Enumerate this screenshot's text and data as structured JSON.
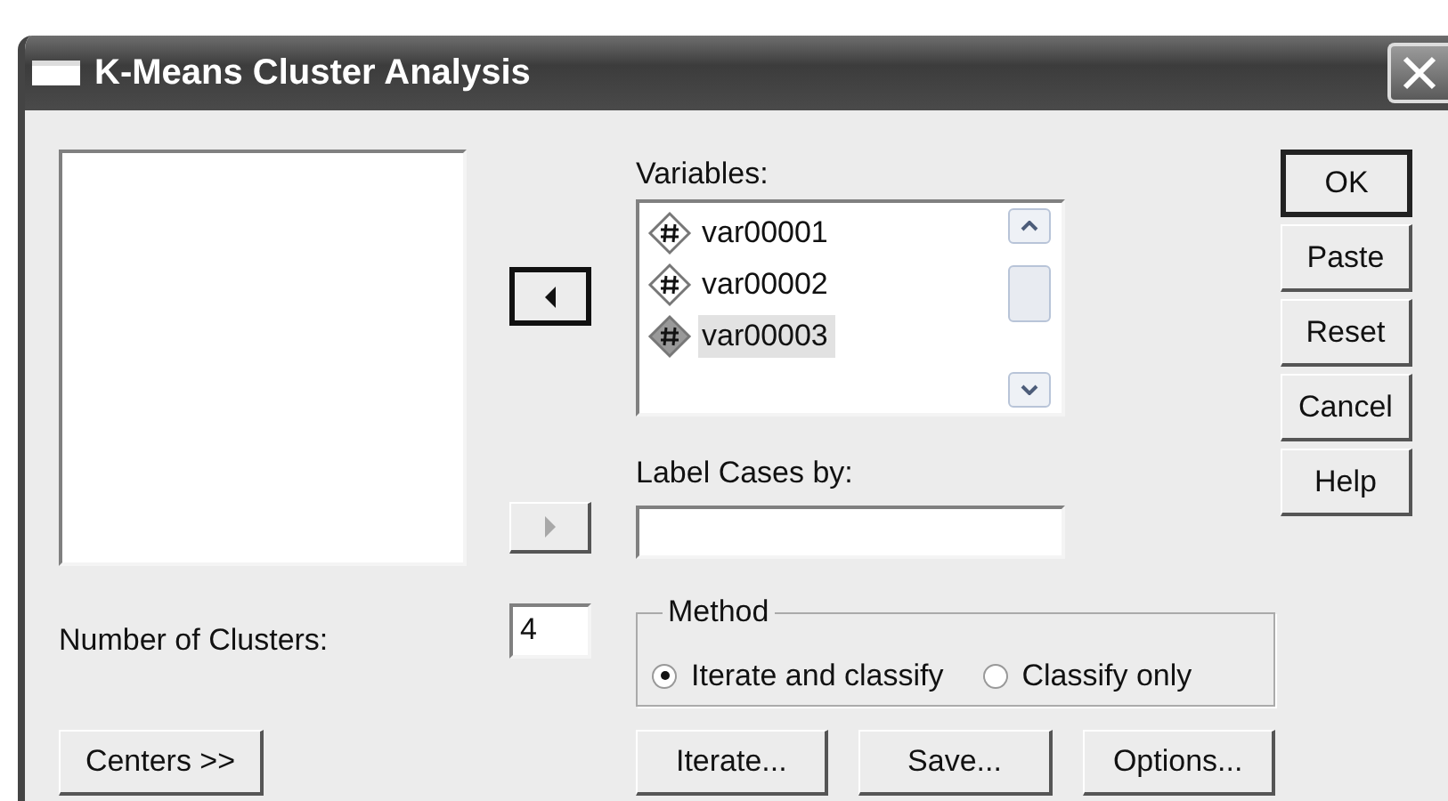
{
  "window": {
    "title": "K-Means Cluster Analysis"
  },
  "move_buttons": [
    {
      "kind": "back",
      "disabled": false,
      "focused": true
    },
    {
      "kind": "forward",
      "disabled": true,
      "focused": false
    }
  ],
  "variables": {
    "label": "Variables:",
    "items": [
      {
        "label": "var00001",
        "selected": false
      },
      {
        "label": "var00002",
        "selected": false
      },
      {
        "label": "var00003",
        "selected": true
      }
    ]
  },
  "label_cases_by": {
    "label": "Label Cases by:"
  },
  "number_of_clusters": {
    "label": "Number of Clusters:",
    "value": "4"
  },
  "method": {
    "legend": "Method",
    "options": [
      {
        "label": "Iterate and classify",
        "selected": true
      },
      {
        "label": "Classify only",
        "selected": false
      }
    ]
  },
  "side_buttons": [
    {
      "label": "OK",
      "default": true
    },
    {
      "label": "Paste",
      "default": false
    },
    {
      "label": "Reset",
      "default": false
    },
    {
      "label": "Cancel",
      "default": false
    },
    {
      "label": "Help",
      "default": false
    }
  ],
  "centers_button": {
    "label": "Centers >>"
  },
  "bottom_buttons": [
    {
      "label": "Iterate..."
    },
    {
      "label": "Save..."
    },
    {
      "label": "Options..."
    }
  ]
}
